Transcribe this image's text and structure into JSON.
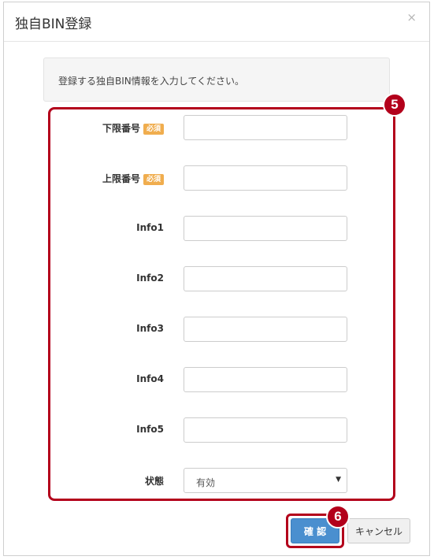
{
  "modal": {
    "title": "独自BIN登録",
    "close_label": "×",
    "info_message": "登録する独自BIN情報を入力してください。"
  },
  "form": {
    "required_label": "必須",
    "fields": [
      {
        "label": "下限番号",
        "value": "",
        "required": true
      },
      {
        "label": "上限番号",
        "value": "",
        "required": true
      },
      {
        "label": "Info1",
        "value": ""
      },
      {
        "label": "Info2",
        "value": ""
      },
      {
        "label": "Info3",
        "value": ""
      },
      {
        "label": "Info4",
        "value": ""
      },
      {
        "label": "Info5",
        "value": ""
      }
    ],
    "status": {
      "label": "状態",
      "selected": "有効"
    }
  },
  "buttons": {
    "confirm_label": "確 認",
    "cancel_label": "キャンセル"
  },
  "annotations": {
    "step_form": "5",
    "step_confirm": "6"
  },
  "colors": {
    "highlight": "#b3001b",
    "primary": "#4a8fcf",
    "required_badge": "#f0ad4e"
  },
  "icons": {
    "close": "close-icon",
    "select_caret": "caret-down-icon"
  }
}
